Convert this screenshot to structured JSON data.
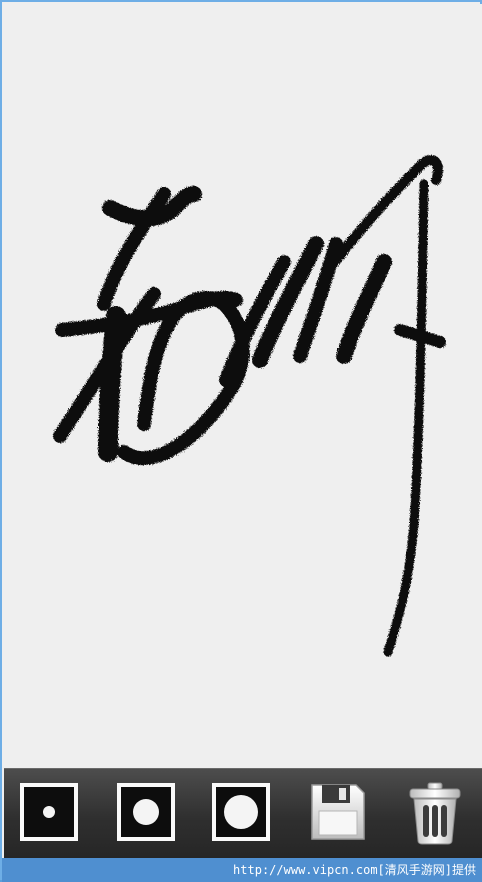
{
  "canvas": {
    "background": "#efefef",
    "ink": "#111111"
  },
  "toolbar": {
    "tools": [
      {
        "name": "small-brush-button",
        "icon": "small-dot-icon"
      },
      {
        "name": "medium-brush-button",
        "icon": "medium-dot-icon"
      },
      {
        "name": "large-brush-button",
        "icon": "large-dot-icon"
      },
      {
        "name": "save-button",
        "icon": "floppy-disk-icon"
      },
      {
        "name": "clear-button",
        "icon": "trash-can-icon"
      }
    ]
  },
  "footer": {
    "watermark": "http://www.vipcn.com[清风手游网]提供"
  }
}
